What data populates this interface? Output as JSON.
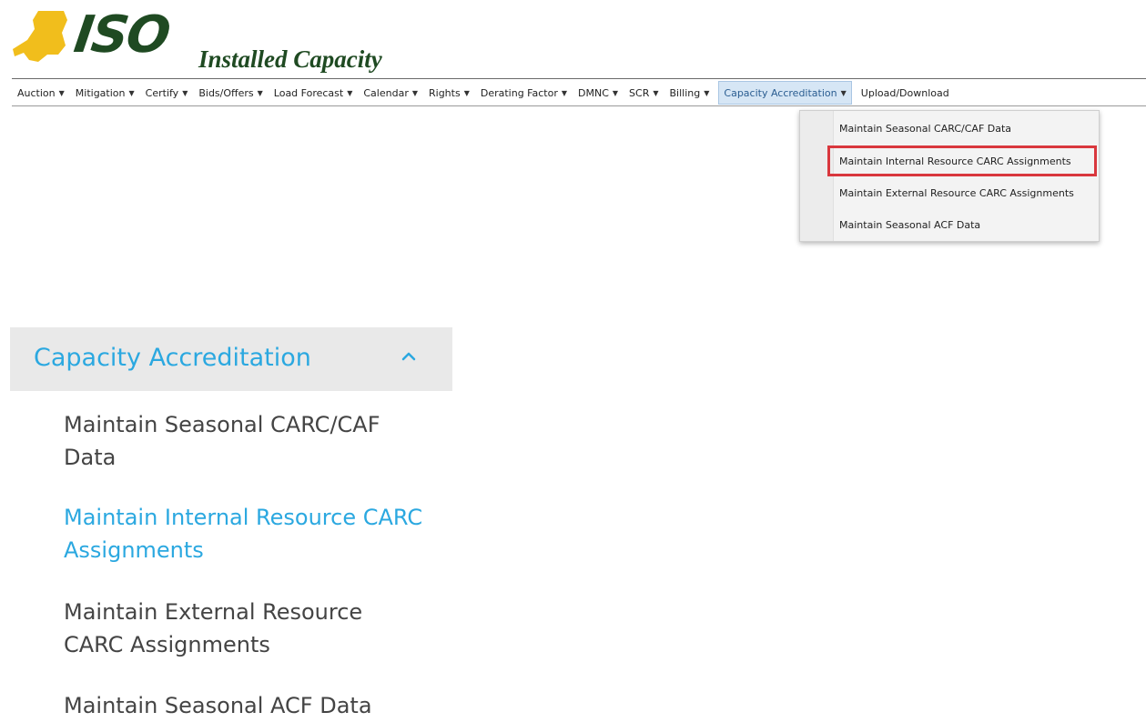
{
  "header": {
    "logo_text": "ISO",
    "app_title": "Installed Capacity"
  },
  "menubar": {
    "items": [
      {
        "label": "Auction"
      },
      {
        "label": "Mitigation"
      },
      {
        "label": "Certify"
      },
      {
        "label": "Bids/Offers"
      },
      {
        "label": "Load Forecast"
      },
      {
        "label": "Calendar"
      },
      {
        "label": "Rights"
      },
      {
        "label": "Derating Factor"
      },
      {
        "label": "DMNC"
      },
      {
        "label": "SCR"
      },
      {
        "label": "Billing"
      },
      {
        "label": "Capacity Accreditation"
      },
      {
        "label": "Upload/Download"
      }
    ],
    "active_item": "Capacity Accreditation"
  },
  "dropdown": {
    "items": [
      {
        "label": "Maintain Seasonal CARC/CAF Data"
      },
      {
        "label": "Maintain Internal Resource CARC Assignments"
      },
      {
        "label": "Maintain External Resource CARC Assignments"
      },
      {
        "label": "Maintain Seasonal ACF Data"
      }
    ],
    "highlighted_item": "Maintain Internal Resource CARC Assignments",
    "highlight_color": "#d9373d"
  },
  "side_panel": {
    "title": "Capacity Accreditation",
    "expanded": true,
    "items": [
      {
        "label": "Maintain Seasonal CARC/CAF Data"
      },
      {
        "label": "Maintain Internal Resource CARC Assignments"
      },
      {
        "label": "Maintain External Resource CARC Assignments"
      },
      {
        "label": "Maintain Seasonal ACF Data"
      }
    ],
    "active_item": "Maintain Internal Resource CARC Assignments",
    "accent_color": "#2ba8e0"
  },
  "colors": {
    "logo_state": "#f1be1c",
    "logo_text": "#1f4a22",
    "menu_active_bg": "#d6e6f5"
  }
}
